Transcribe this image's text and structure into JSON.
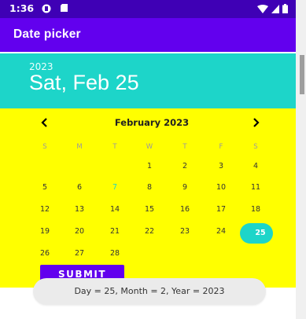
{
  "status_bar": {
    "time": "1:36",
    "icons": [
      "circle-app-icon",
      "sd-card-icon",
      "wifi-icon",
      "signal-icon",
      "battery-icon"
    ]
  },
  "app_bar": {
    "title": "Date picker"
  },
  "date_picker": {
    "header": {
      "year": "2023",
      "date": "Sat, Feb 25"
    },
    "month_title": "February 2023",
    "prev_icon": "chevron-left-icon",
    "next_icon": "chevron-right-icon",
    "weekdays": [
      "S",
      "M",
      "T",
      "W",
      "T",
      "F",
      "S"
    ],
    "weeks": [
      [
        "",
        "",
        "",
        "1",
        "2",
        "3",
        "4"
      ],
      [
        "5",
        "6",
        "7",
        "8",
        "9",
        "10",
        "11"
      ],
      [
        "12",
        "13",
        "14",
        "15",
        "16",
        "17",
        "18"
      ],
      [
        "19",
        "20",
        "21",
        "22",
        "23",
        "24",
        "25"
      ],
      [
        "26",
        "27",
        "28",
        "",
        "",
        "",
        ""
      ]
    ],
    "today_day": "7",
    "selected_day": "25"
  },
  "submit_button": {
    "label": "SUBMIT"
  },
  "toast": {
    "message": "Day = 25, Month = 2, Year = 2023"
  },
  "colors": {
    "status_bar": "#3f00b5",
    "app_bar": "#6200ee",
    "accent": "#1dd5c9",
    "calendar_background": "#ffff00",
    "button": "#6200ee"
  }
}
